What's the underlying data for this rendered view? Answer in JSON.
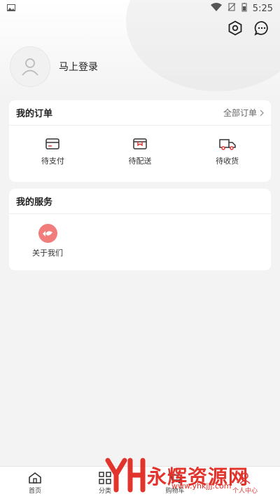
{
  "status_bar": {
    "time": "5:25"
  },
  "profile": {
    "login_label": "马上登录"
  },
  "orders": {
    "title": "我的订单",
    "all_label": "全部订单",
    "items": [
      {
        "label": "待支付",
        "icon": "wallet-icon"
      },
      {
        "label": "待配送",
        "icon": "package-icon"
      },
      {
        "label": "待收货",
        "icon": "truck-icon"
      }
    ]
  },
  "services": {
    "title": "我的服务",
    "items": [
      {
        "label": "关于我们",
        "icon": "about-icon"
      }
    ]
  },
  "tab_bar": {
    "items": [
      {
        "label": "首页",
        "icon": "home-icon"
      },
      {
        "label": "分类",
        "icon": "grid-icon"
      },
      {
        "label": "购物车",
        "icon": "cart-icon"
      },
      {
        "label": "个人中心",
        "icon": "user-icon",
        "active": true
      }
    ]
  },
  "watermark": {
    "brand": "永辉资源网",
    "url": "www.yhkjjj.com"
  },
  "colors": {
    "accent": "#e03a3a",
    "service_icon": "#f07c7c"
  }
}
